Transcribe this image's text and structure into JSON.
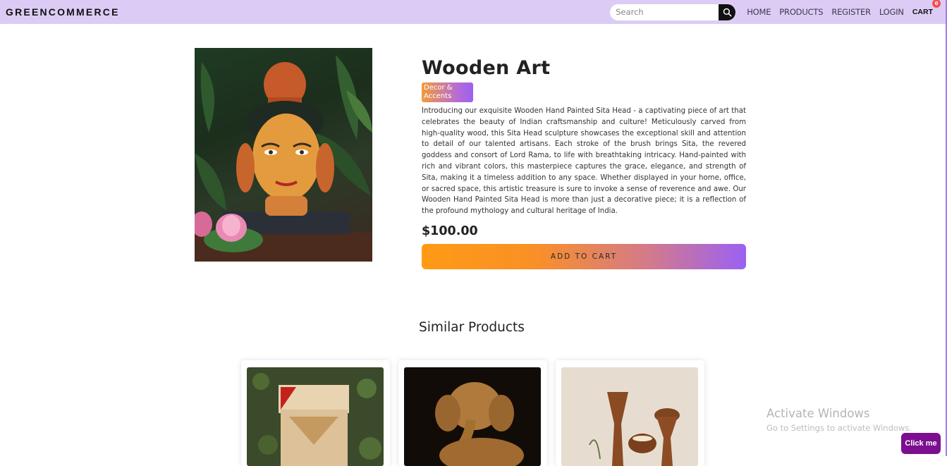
{
  "navbar": {
    "brand": "GREENCOMMERCE",
    "search_placeholder": "Search",
    "links": [
      "HOME",
      "PRODUCTS",
      "REGISTER",
      "LOGIN"
    ],
    "cart_label": "CART",
    "cart_count": "0"
  },
  "product": {
    "title": "Wooden Art",
    "category": "Decor & Accents",
    "description": "Introducing our exquisite Wooden Hand Painted Sita Head - a captivating piece of art that celebrates the beauty of Indian craftsmanship and culture! Meticulously carved from high-quality wood, this Sita Head sculpture showcases the exceptional skill and attention to detail of our talented artisans. Each stroke of the brush brings Sita, the revered goddess and consort of Lord Rama, to life with breathtaking intricacy. Hand-painted with rich and vibrant colors, this masterpiece captures the grace, elegance, and strength of Sita, making it a timeless addition to any space. Whether displayed in your home, office, or sacred space, this artistic treasure is sure to invoke a sense of reverence and awe. Our Wooden Hand Painted Sita Head is more than just a decorative piece; it is a reflection of the profound mythology and cultural heritage of India.",
    "price": "$100.00",
    "add_to_cart_label": "ADD TO CART"
  },
  "similar": {
    "title": "Similar Products"
  },
  "watermark": {
    "title": "Activate Windows",
    "subtitle": "Go to Settings to activate Windows."
  },
  "floating_button": "Click me",
  "colors": {
    "navbar_bg": "#dcccf5",
    "accent_orange": "#ff9a15",
    "accent_purple": "#9b61f4",
    "floating_button": "#7b0f8f"
  }
}
